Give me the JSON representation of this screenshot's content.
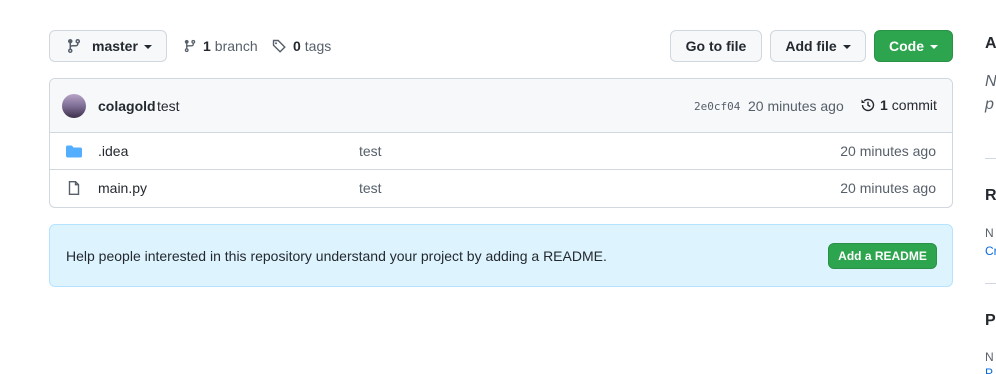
{
  "branch": {
    "name": "master"
  },
  "branches": {
    "count": "1",
    "label": "branch"
  },
  "tags": {
    "count": "0",
    "label": "tags"
  },
  "actions": {
    "goto_file": "Go to file",
    "add_file": "Add file",
    "code": "Code"
  },
  "commit": {
    "author": "colagold",
    "message": "test",
    "sha": "2e0cf04",
    "time": "20 minutes ago",
    "count": "1",
    "count_label": "commit"
  },
  "files": [
    {
      "name": ".idea",
      "type": "folder",
      "commit_message": "test",
      "age": "20 minutes ago"
    },
    {
      "name": "main.py",
      "type": "file",
      "commit_message": "test",
      "age": "20 minutes ago"
    }
  ],
  "readme": {
    "text": "Help people interested in this repository understand your project by adding a README.",
    "button": "Add a README"
  },
  "sidebar": {
    "about_head": "A",
    "about_desc_1": "N",
    "about_desc_2": "p",
    "releases_head": "R",
    "releases_text": "N",
    "releases_link": "Cr",
    "packages_head": "P",
    "packages_text": "N",
    "packages_link": "P"
  },
  "colors": {
    "primary_green": "#2da44e",
    "folder_blue": "#54aeff",
    "banner_bg": "#ddf4ff",
    "link_blue": "#0969da"
  }
}
